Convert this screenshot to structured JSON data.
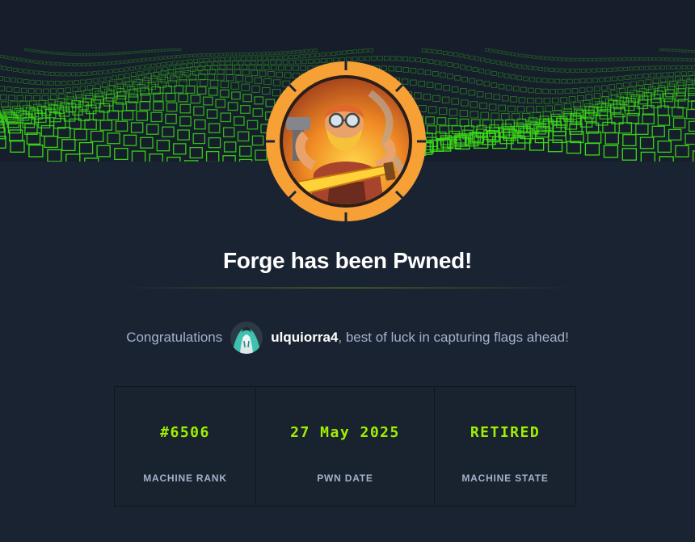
{
  "machine": {
    "name": "Forge",
    "avatar_icon": "blacksmith-avatar-icon"
  },
  "title": "Forge has been Pwned!",
  "congrats": {
    "prefix": "Congratulations",
    "username": "ulquiorra4",
    "suffix": ", best of luck in capturing flags ahead!",
    "avatar_icon": "user-avatar-icon"
  },
  "stats": [
    {
      "value": "#6506",
      "label": "MACHINE RANK"
    },
    {
      "value": "27 May 2025",
      "label": "PWN DATE"
    },
    {
      "value": "RETIRED",
      "label": "MACHINE STATE"
    }
  ],
  "colors": {
    "background": "#1a2332",
    "accent_green": "#9fef00",
    "label_text": "#a4b1cd",
    "avatar_ring": "#f7a035"
  }
}
